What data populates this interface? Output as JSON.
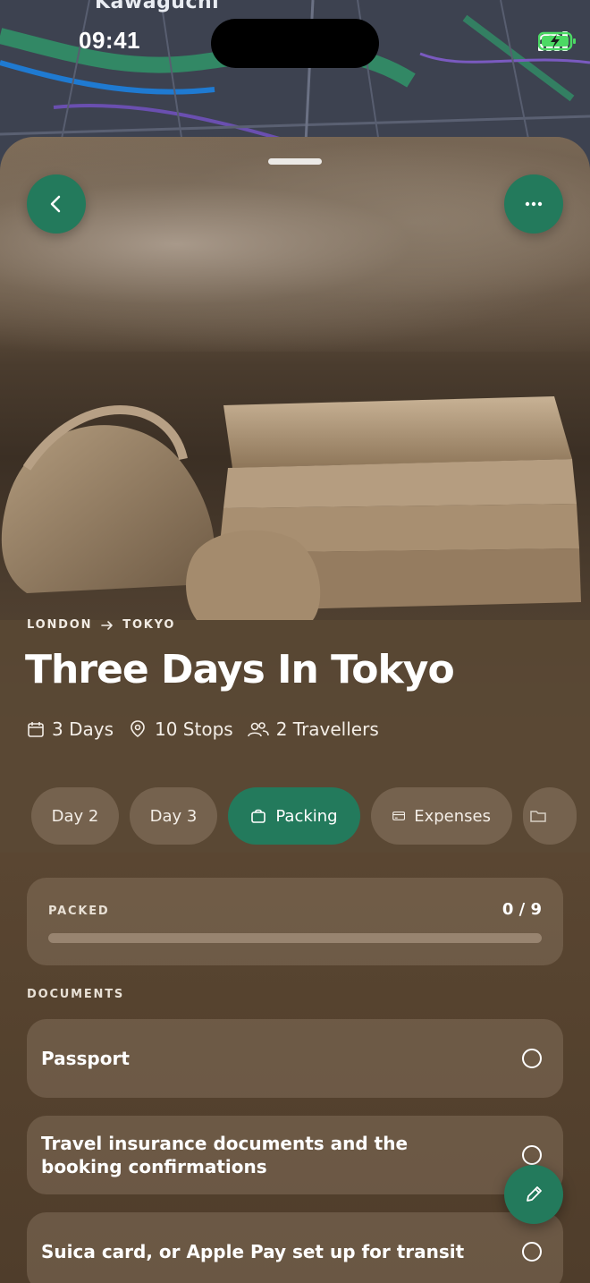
{
  "status_bar": {
    "time": "09:41"
  },
  "map": {
    "label": "Kawaguchi"
  },
  "trip": {
    "route_from": "LONDON",
    "route_to": "TOKYO",
    "title": "Three Days In Tokyo",
    "days": "3 Days",
    "stops": "10 Stops",
    "travellers": "2 Travellers"
  },
  "tabs": [
    {
      "label": "Day 2"
    },
    {
      "label": "Day 3"
    },
    {
      "label": "Packing",
      "icon": "bag-icon",
      "active": true
    },
    {
      "label": "Expenses",
      "icon": "card-icon"
    },
    {
      "label": "",
      "icon": "folder-icon"
    }
  ],
  "packing": {
    "label": "PACKED",
    "count": "0 / 9",
    "progress": 0
  },
  "sections": [
    {
      "label": "DOCUMENTS",
      "items": [
        {
          "text": "Passport",
          "checked": false
        },
        {
          "text": "Travel insurance documents and the booking confirmations",
          "checked": false
        },
        {
          "text": "Suica card, or Apple Pay set up for transit",
          "checked": false
        }
      ]
    }
  ],
  "colors": {
    "accent": "#237a5c",
    "sheet": "#4f3d2b"
  }
}
